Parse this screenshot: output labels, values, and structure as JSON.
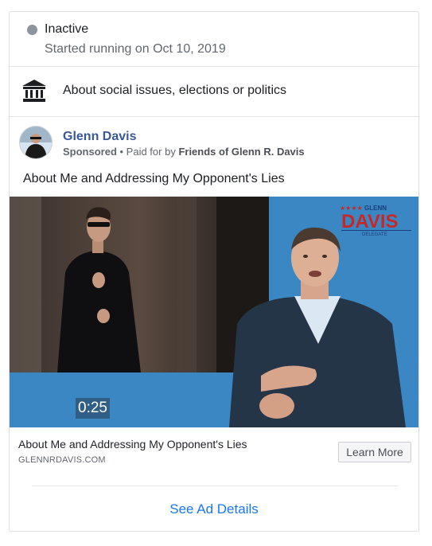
{
  "status": {
    "label": "Inactive",
    "started": "Started running on Oct 10, 2019"
  },
  "category": {
    "icon": "bank-icon",
    "text": "About social issues, elections or politics"
  },
  "ad": {
    "page_name": "Glenn Davis",
    "sponsored": "Sponsored",
    "paid_for_prefix": " • Paid for by ",
    "paid_for_name": "Friends of Glenn R. Davis",
    "text": "About Me and Addressing My Opponent's Lies",
    "video_duration": "0:25",
    "logo": {
      "stars": "★★★★",
      "top": "GLENN",
      "main": "DAVIS",
      "sub": "DELEGATE"
    },
    "link_title": "About Me and Addressing My Opponent's Lies",
    "link_domain": "GLENNRDAVIS.COM",
    "cta": "Learn More"
  },
  "footer": {
    "details_link": "See Ad Details"
  },
  "colors": {
    "link_blue": "#1877f2",
    "page_name": "#385898",
    "video_bg": "#3b87c3",
    "inactive_dot": "#8d949e"
  }
}
